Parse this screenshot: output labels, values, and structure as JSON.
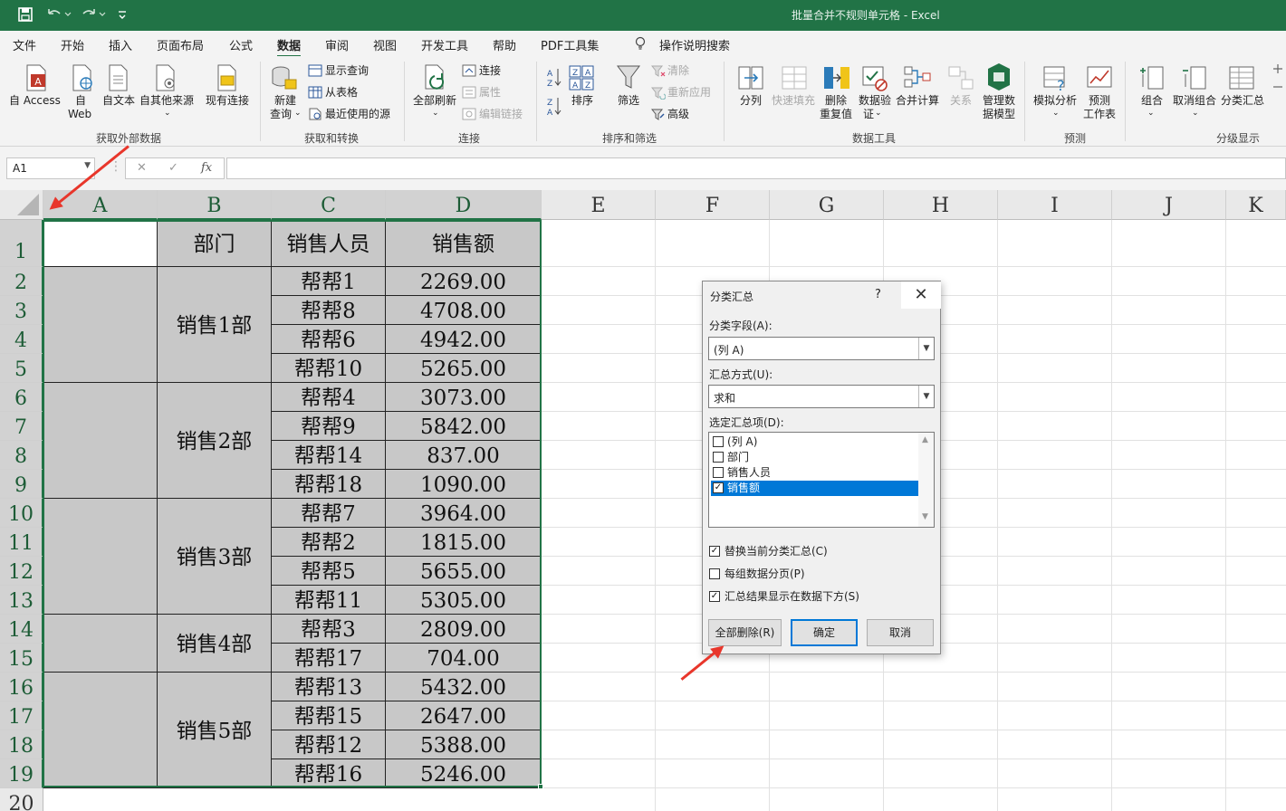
{
  "window": {
    "title": "批量合并不规则单元格  -  Excel",
    "quick_access": [
      "save-icon",
      "undo-icon",
      "redo-icon",
      "customize-icon"
    ]
  },
  "menu": {
    "tabs": [
      "文件",
      "开始",
      "插入",
      "页面布局",
      "公式",
      "数据",
      "审阅",
      "视图",
      "开发工具",
      "帮助",
      "PDF工具集",
      "操作说明搜索"
    ],
    "active": "数据"
  },
  "ribbon": {
    "get_external": {
      "access": "自 Access",
      "web_1": "自",
      "web_2": "Web",
      "text": "自文本",
      "other": "自其他来源",
      "existing": "现有连接",
      "group": "获取外部数据"
    },
    "get_transform": {
      "new_query_1": "新建",
      "new_query_2": "查询",
      "show_queries": "显示查询",
      "from_table": "从表格",
      "recent_sources": "最近使用的源",
      "group": "获取和转换"
    },
    "connections": {
      "refresh_all": "全部刷新",
      "connections": "连接",
      "properties": "属性",
      "edit_links": "编辑链接",
      "group": "连接"
    },
    "sort_filter": {
      "sort": "排序",
      "filter": "筛选",
      "clear": "清除",
      "reapply": "重新应用",
      "advanced": "高级",
      "group": "排序和筛选"
    },
    "data_tools": {
      "text_to_columns": "分列",
      "flash_fill": "快速填充",
      "remove_dup_1": "删除",
      "remove_dup_2": "重复值",
      "validation_1": "数据验",
      "validation_2": "证",
      "consolidate": "合并计算",
      "relationships": "关系",
      "data_model_1": "管理数",
      "data_model_2": "据模型",
      "group": "数据工具"
    },
    "forecast": {
      "what_if": "模拟分析",
      "forecast_sheet_1": "预测",
      "forecast_sheet_2": "工作表",
      "group": "预测"
    },
    "outline": {
      "group_btn": "组合",
      "ungroup": "取消组合",
      "subtotal": "分类汇总",
      "group": "分级显示"
    }
  },
  "formula_bar": {
    "name_box": "A1",
    "cancel": "✕",
    "enter": "✓",
    "fx": "fx",
    "formula": ""
  },
  "sheet": {
    "columns": [
      "A",
      "B",
      "C",
      "D",
      "E",
      "F",
      "G",
      "H",
      "I",
      "J",
      "K"
    ],
    "rows": [
      "1",
      "2",
      "3",
      "4",
      "5",
      "6",
      "7",
      "8",
      "9",
      "10",
      "11",
      "12",
      "13",
      "14",
      "15",
      "16",
      "17",
      "18",
      "19",
      "20"
    ],
    "header": {
      "dept": "部门",
      "person": "销售人员",
      "amount": "销售额"
    },
    "departments": [
      "销售1部",
      "销售2部",
      "销售3部",
      "销售4部",
      "销售5部"
    ],
    "persons": [
      "帮帮1",
      "帮帮8",
      "帮帮6",
      "帮帮10",
      "帮帮4",
      "帮帮9",
      "帮帮14",
      "帮帮18",
      "帮帮7",
      "帮帮2",
      "帮帮5",
      "帮帮11",
      "帮帮3",
      "帮帮17",
      "帮帮13",
      "帮帮15",
      "帮帮12",
      "帮帮16"
    ],
    "amounts": [
      "2269.00",
      "4708.00",
      "4942.00",
      "5265.00",
      "3073.00",
      "5842.00",
      "837.00",
      "1090.00",
      "3964.00",
      "1815.00",
      "5655.00",
      "5305.00",
      "2809.00",
      "704.00",
      "5432.00",
      "2647.00",
      "5388.00",
      "5246.00"
    ]
  },
  "dialog": {
    "title": "分类汇总",
    "help": "?",
    "close": "✕",
    "field_label": "分类字段(A):",
    "field_value": "(列 A)",
    "method_label": "汇总方式(U):",
    "method_value": "求和",
    "items_label": "选定汇总项(D):",
    "items": [
      {
        "label": "(列 A)",
        "checked": ""
      },
      {
        "label": "部门",
        "checked": ""
      },
      {
        "label": "销售人员",
        "checked": ""
      },
      {
        "label": "销售额",
        "checked": "✓"
      }
    ],
    "opt_replace": "替换当前分类汇总(C)",
    "opt_pagebreak": "每组数据分页(P)",
    "opt_below": "汇总结果显示在数据下方(S)",
    "check_mark": "✓",
    "btn_remove_all": "全部删除(R)",
    "btn_ok": "确定",
    "btn_cancel": "取消"
  }
}
